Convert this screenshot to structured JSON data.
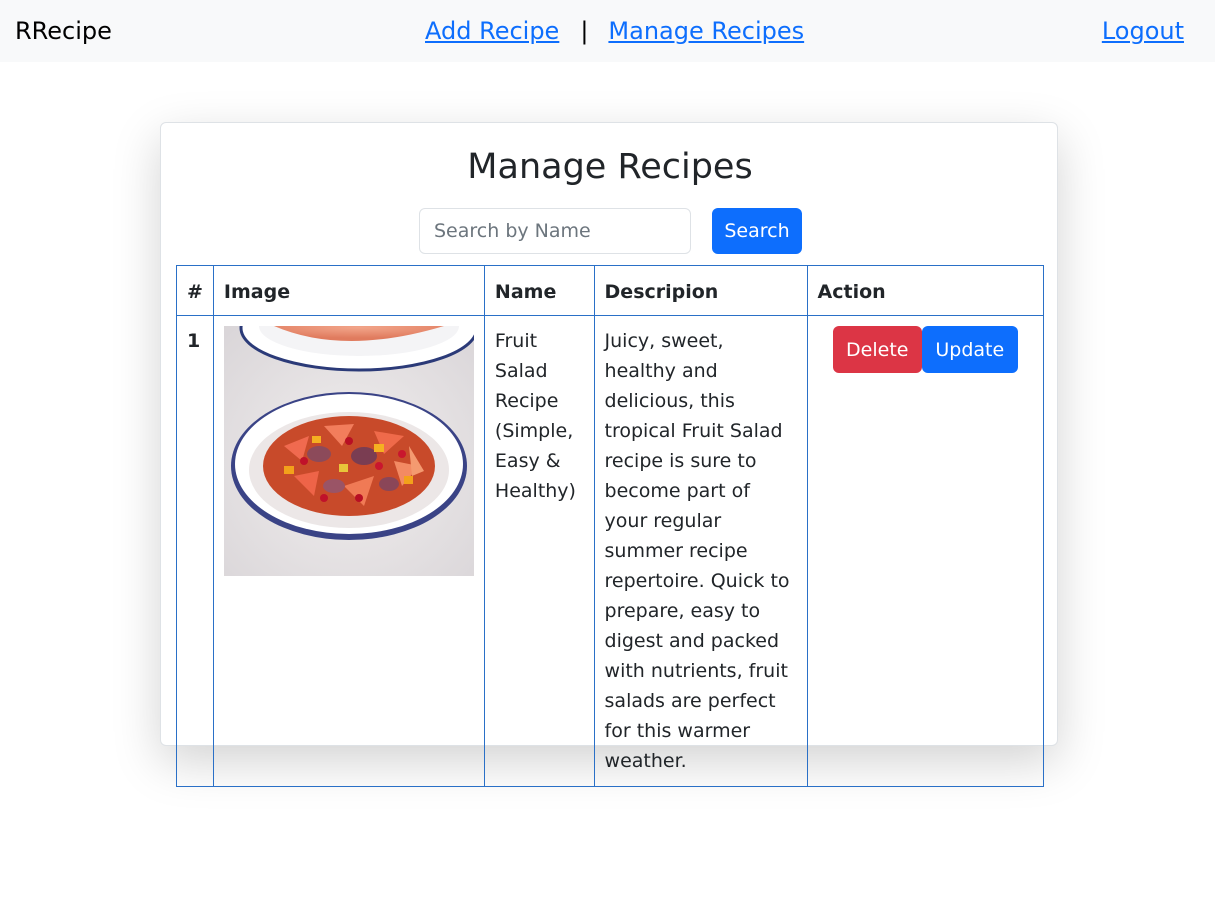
{
  "navbar": {
    "brand": "RRecipe",
    "add_recipe": "Add Recipe",
    "separator": "|",
    "manage_recipes": "Manage Recipes",
    "logout": "Logout"
  },
  "page": {
    "title": "Manage Recipes"
  },
  "search": {
    "placeholder": "Search by Name",
    "value": "",
    "button_label": "Search"
  },
  "table": {
    "headers": [
      "#",
      "Image",
      "Name",
      "Descripion",
      "Action"
    ],
    "rows": [
      {
        "index": "1",
        "image": "fruit-salad-bowl-photo",
        "name": "Fruit Salad Recipe (Simple, Easy & Healthy)",
        "description": "Juicy, sweet, healthy and delicious, this tropical Fruit Salad recipe is sure to become part of your regular summer recipe repertoire. Quick to prepare, easy to digest and packed with nutrients, fruit salads are perfect for this warmer weather.",
        "delete_label": "Delete",
        "update_label": "Update"
      }
    ]
  },
  "colors": {
    "primary": "#0d6efd",
    "danger": "#dc3545",
    "navbar_bg": "#f8f9fa",
    "table_border": "#2a70c7"
  }
}
